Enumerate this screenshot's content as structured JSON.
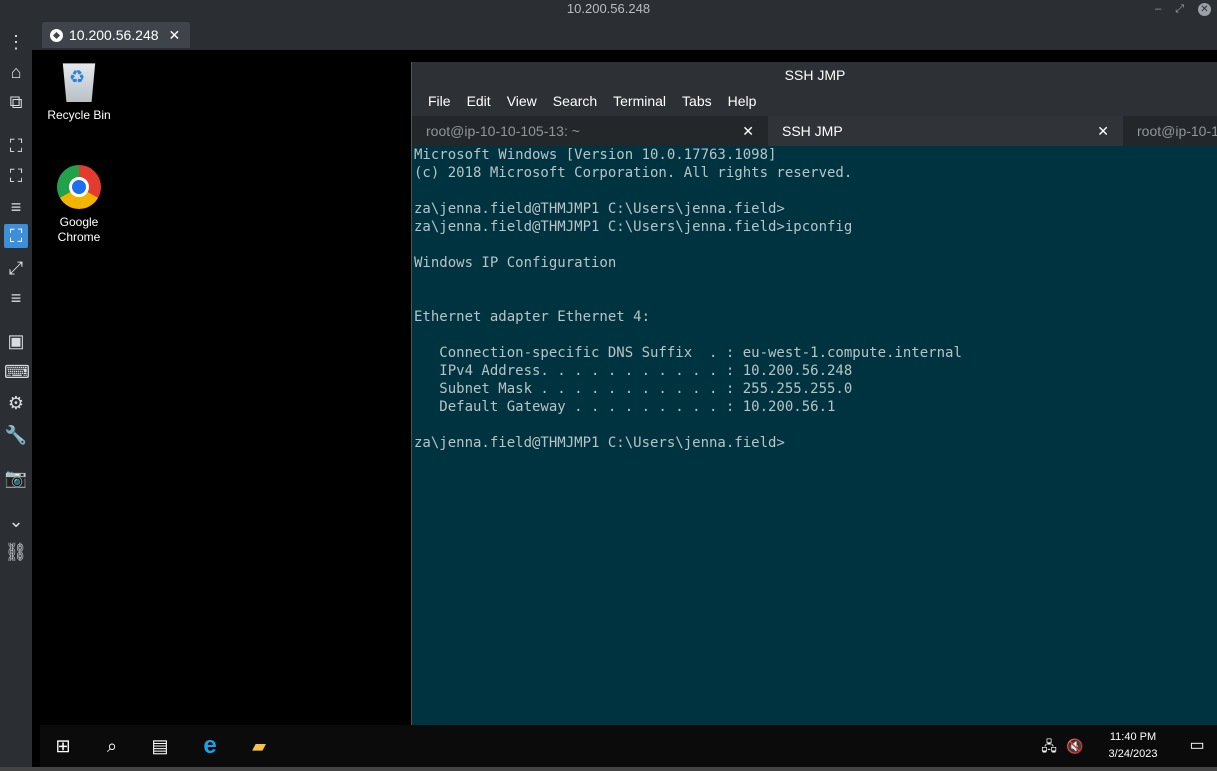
{
  "app": {
    "title": "10.200.56.248"
  },
  "connection_tab": {
    "label": "10.200.56.248",
    "close": "✕"
  },
  "desktop": {
    "icons": [
      {
        "label_line1": "Recycle Bin",
        "label_line2": ""
      },
      {
        "label_line1": "Google",
        "label_line2": "Chrome"
      }
    ]
  },
  "terminal": {
    "title": "SSH JMP",
    "menu": [
      "File",
      "Edit",
      "View",
      "Search",
      "Terminal",
      "Tabs",
      "Help"
    ],
    "tabs": [
      {
        "label": "root@ip-10-10-105-13: ~",
        "close": "✕"
      },
      {
        "label": "SSH JMP",
        "close": "✕"
      },
      {
        "label": "root@ip-10-1"
      }
    ],
    "output": "Microsoft Windows [Version 10.0.17763.1098]\n(c) 2018 Microsoft Corporation. All rights reserved.\n\nza\\jenna.field@THMJMP1 C:\\Users\\jenna.field>\nza\\jenna.field@THMJMP1 C:\\Users\\jenna.field>ipconfig\n\nWindows IP Configuration\n\n\nEthernet adapter Ethernet 4:\n\n   Connection-specific DNS Suffix  . : eu-west-1.compute.internal\n   IPv4 Address. . . . . . . . . . . : 10.200.56.248\n   Subnet Mask . . . . . . . . . . . : 255.255.255.0\n   Default Gateway . . . . . . . . . : 10.200.56.1\n\nza\\jenna.field@THMJMP1 C:\\Users\\jenna.field>"
  },
  "taskbar": {
    "time": "11:40 PM",
    "date": "3/24/2023"
  },
  "colors": {
    "terminal_bg": "#003340",
    "active_tool": "#3d8fd9"
  }
}
